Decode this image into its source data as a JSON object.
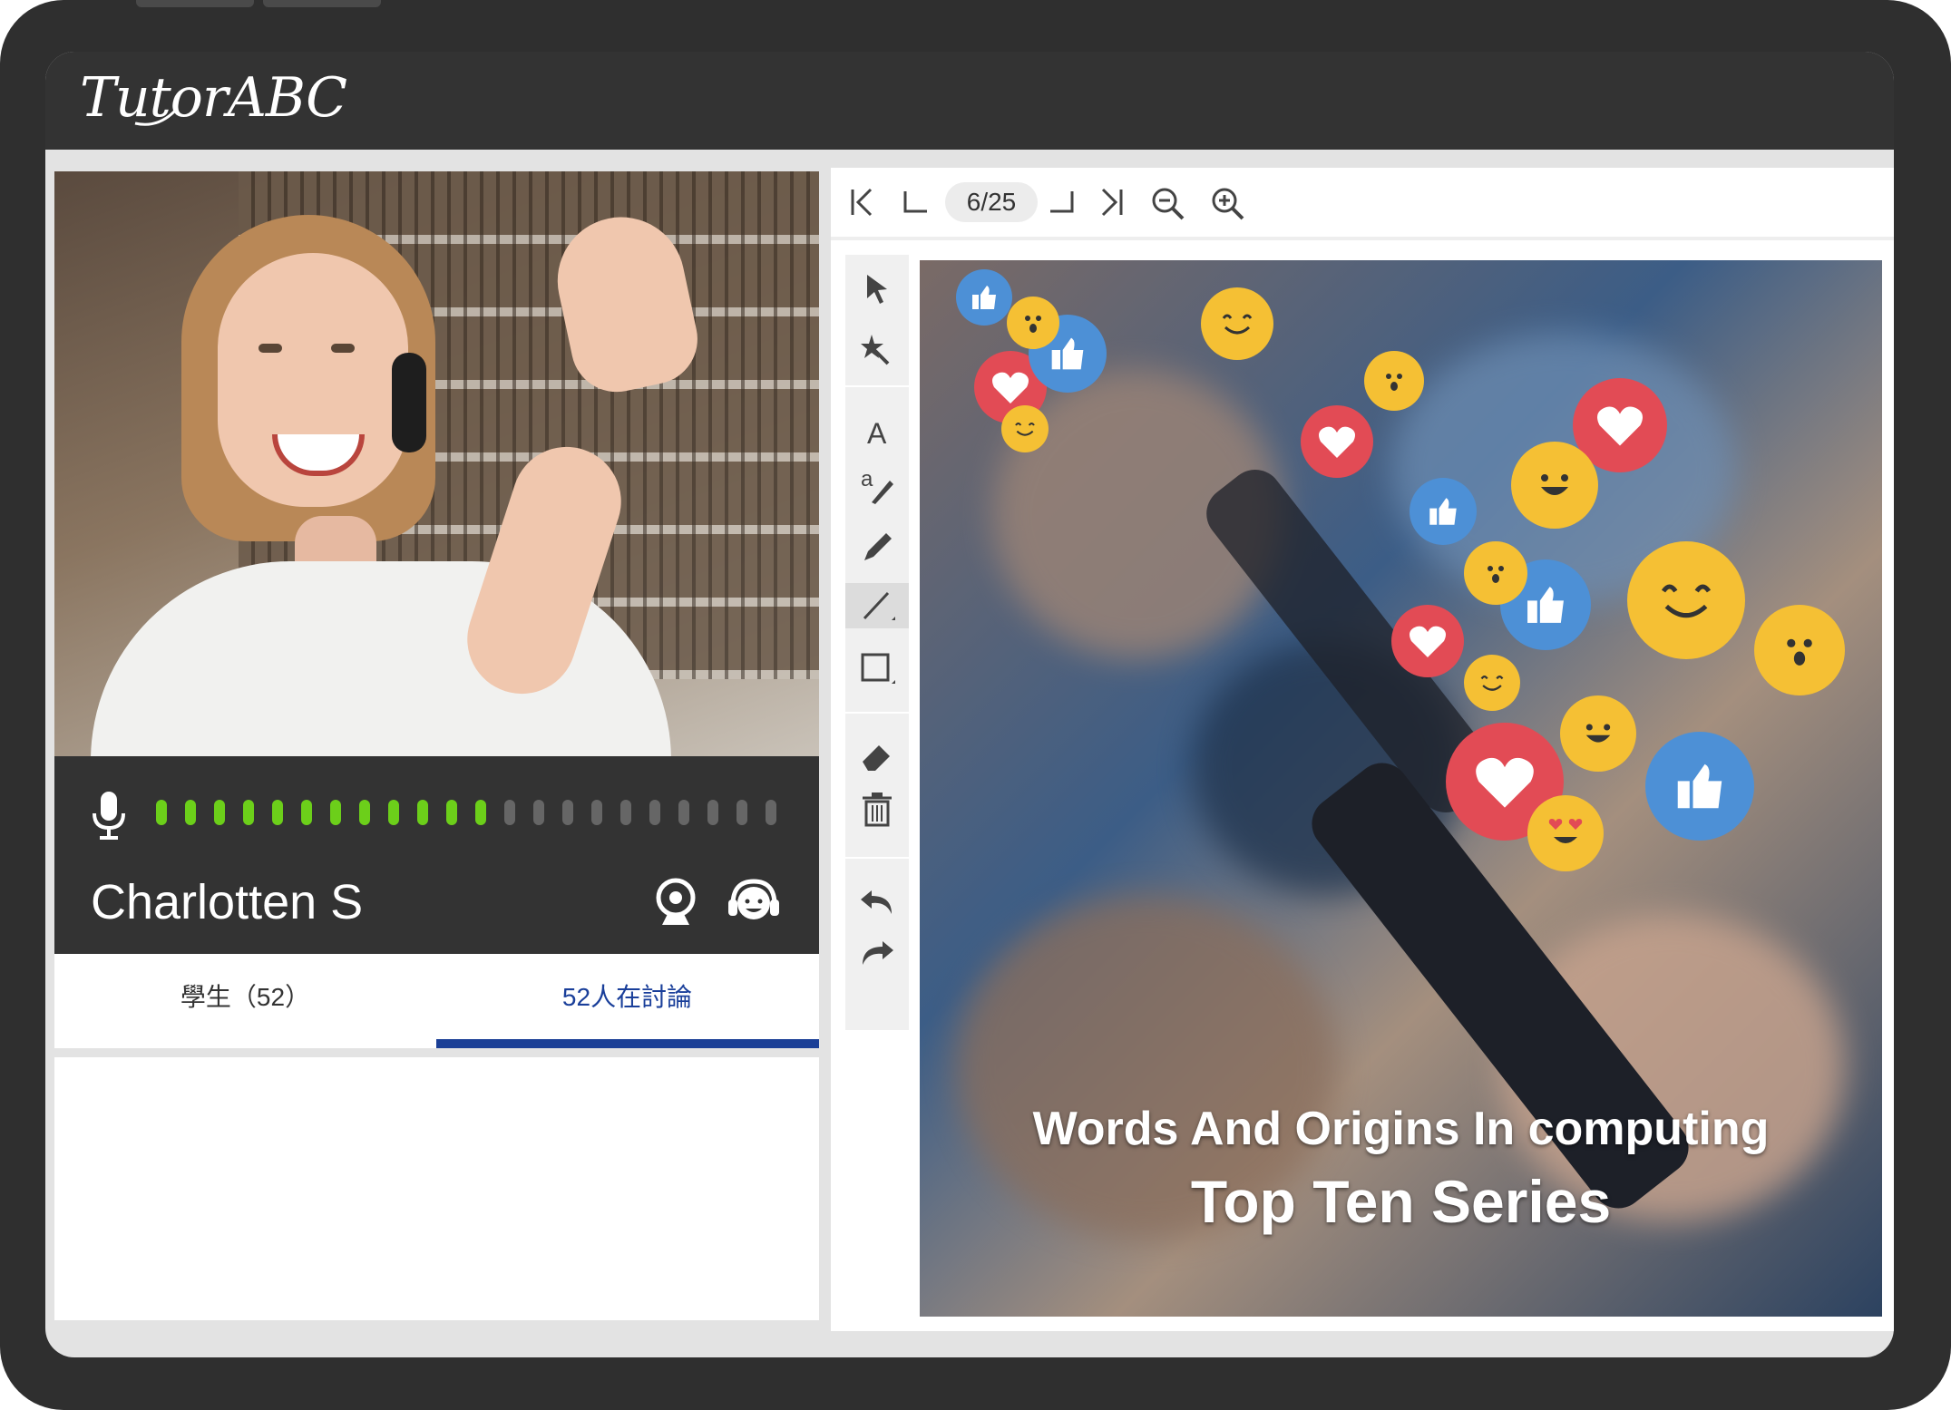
{
  "app": {
    "title": "TutorABC"
  },
  "participant": {
    "name": "Charlotten S",
    "mic_level_active": 12,
    "mic_level_total": 22
  },
  "tabs": [
    {
      "label": "學生（52）",
      "active": false
    },
    {
      "label": "52人在討論",
      "active": true
    }
  ],
  "pager": {
    "page_label": "6/25"
  },
  "toolbar": {
    "tools": [
      "pointer-icon",
      "laser-icon",
      "text-icon",
      "highlighter-icon",
      "pen-icon",
      "line-icon",
      "rectangle-icon",
      "eraser-icon",
      "trash-icon",
      "undo-icon",
      "redo-icon"
    ],
    "active_tool": "line-icon"
  },
  "slide": {
    "line1": "Words And Origins In computing",
    "line2": "Top Ten Series"
  },
  "colors": {
    "frame": "#2f2f2f",
    "header": "#333333",
    "accent": "#1b3f96",
    "mic_active": "#6ccf1a"
  }
}
